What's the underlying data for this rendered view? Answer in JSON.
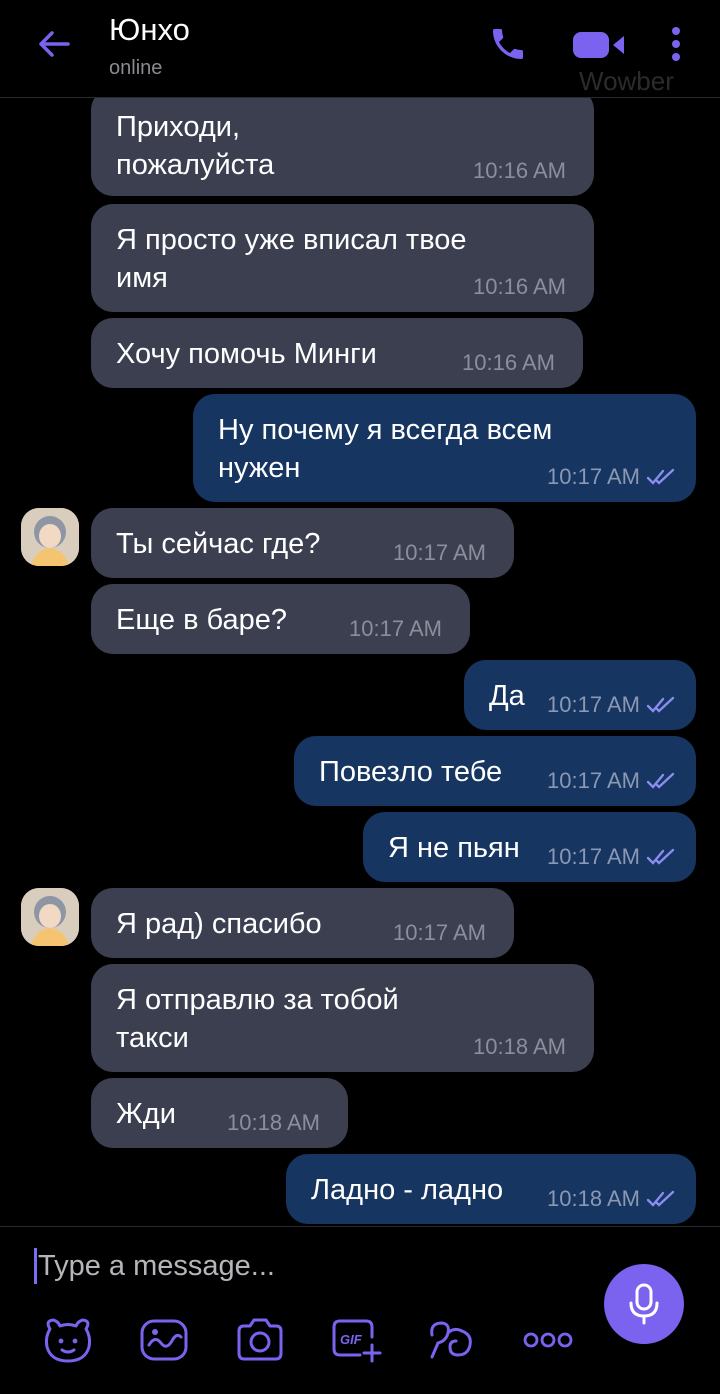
{
  "header": {
    "title": "Юнхо",
    "status": "online",
    "watermark": "Wowber"
  },
  "colors": {
    "accent": "#7b63f0",
    "incoming_bubble": "#3b3f50",
    "outgoing_bubble": "#163560",
    "background": "#000000"
  },
  "messages": [
    {
      "dir": "in",
      "text": "Приходи,\nпожалуйста",
      "time": "10:16 AM"
    },
    {
      "dir": "in",
      "text": "Я просто уже вписал твое\nимя",
      "time": "10:16 AM"
    },
    {
      "dir": "in",
      "text": "Хочу помочь Минги",
      "time": "10:16 AM"
    },
    {
      "dir": "out",
      "text": "Ну почему я всегда всем\nнужен",
      "time": "10:17 AM",
      "status": "read"
    },
    {
      "dir": "in",
      "text": "Ты сейчас где?",
      "time": "10:17 AM",
      "avatar": true
    },
    {
      "dir": "in",
      "text": "Еще в баре?",
      "time": "10:17 AM"
    },
    {
      "dir": "out",
      "text": "Да",
      "time": "10:17 AM",
      "status": "read"
    },
    {
      "dir": "out",
      "text": "Повезло тебе",
      "time": "10:17 AM",
      "status": "read"
    },
    {
      "dir": "out",
      "text": "Я не пьян",
      "time": "10:17 AM",
      "status": "read"
    },
    {
      "dir": "in",
      "text": "Я рад) спасибо",
      "time": "10:17 AM",
      "avatar": true
    },
    {
      "dir": "in",
      "text": "Я отправлю за тобой\nтакси",
      "time": "10:18 AM"
    },
    {
      "dir": "in",
      "text": "Жди",
      "time": "10:18 AM"
    },
    {
      "dir": "out",
      "text": "Ладно - ладно",
      "time": "10:18 AM",
      "status": "read"
    }
  ],
  "composer": {
    "placeholder": "Type a message..."
  },
  "icons": {
    "back": "arrow-left-icon",
    "call": "phone-icon",
    "video": "video-camera-icon",
    "more": "more-vertical-icon",
    "mic": "microphone-icon",
    "tools": [
      "sticker-icon",
      "doodle-icon",
      "camera-icon",
      "gif-icon",
      "emoticon-icon",
      "more-horizontal-icon"
    ]
  }
}
